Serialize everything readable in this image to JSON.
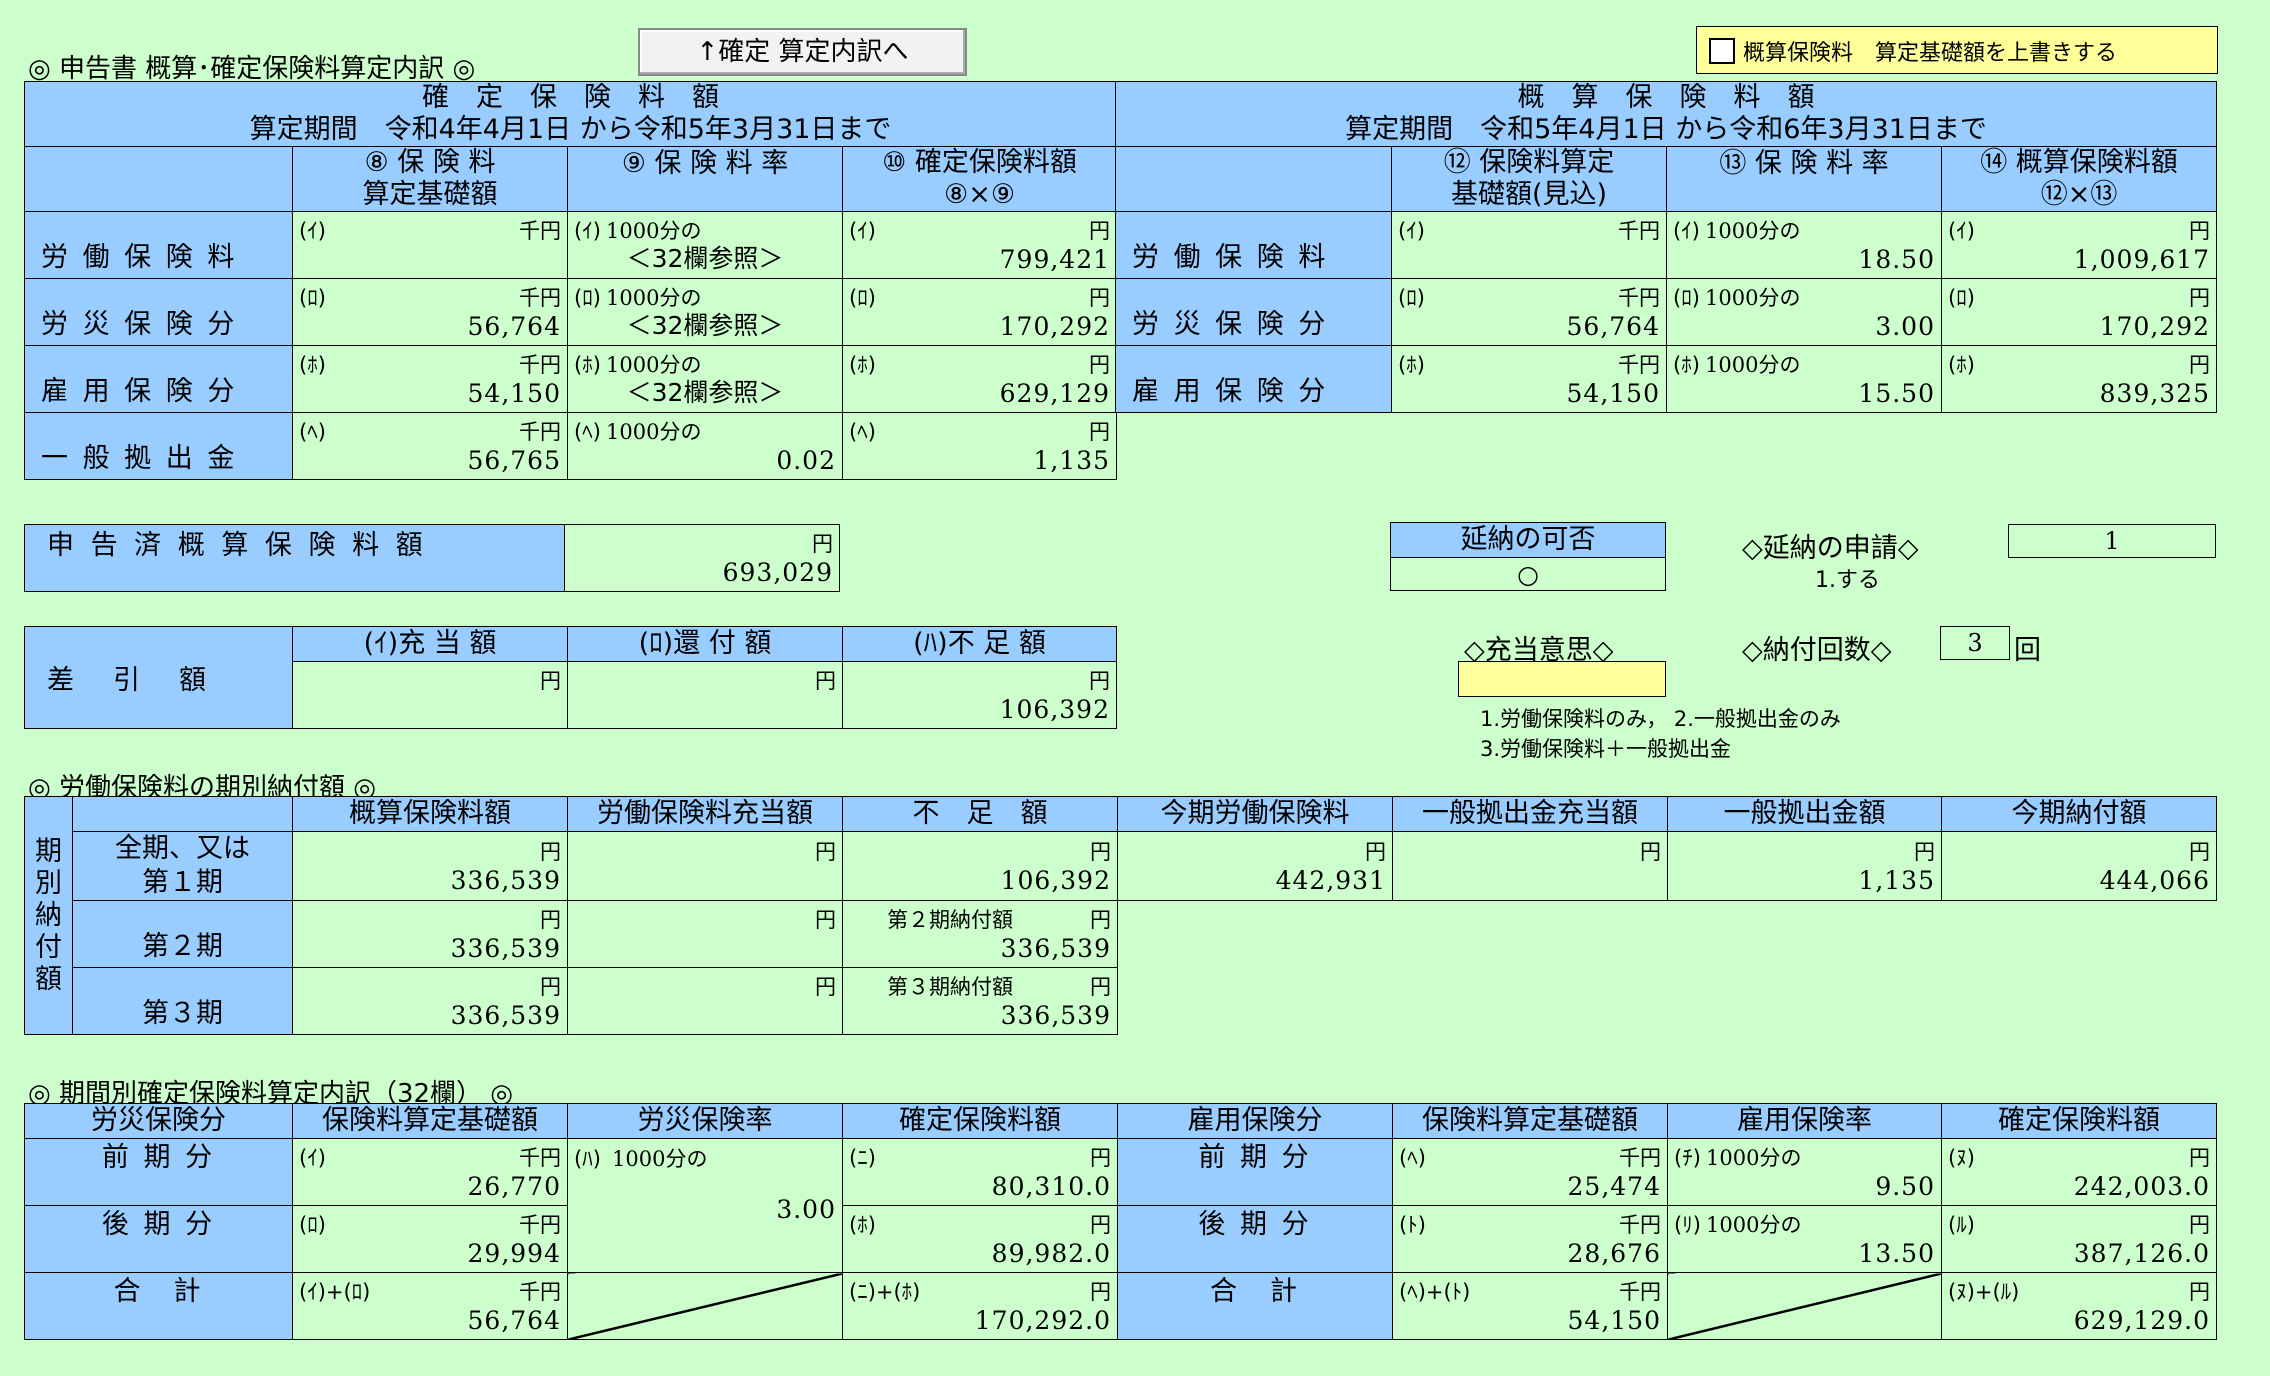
{
  "header": {
    "title": "◎ 申告書 概算･確定保険料算定内訳 ◎",
    "jump_button": "↑確定 算定内訳へ",
    "override_checkbox": "概算保険料　算定基礎額を上書きする"
  },
  "main_table": {
    "kakutei": {
      "title": "確　定　保　険　料　額",
      "period": "算定期間　令和4年4月1日 から令和5年3月31日まで",
      "col8": [
        "⑧ 保 険 料",
        "算定基礎額"
      ],
      "col9": "⑨ 保 険 料 率",
      "col10": [
        "⑩ 確定保険料額",
        "⑧×⑨"
      ],
      "rows": [
        {
          "label": "労 働 保 険 料",
          "m8": "(ｲ)",
          "u8": "千円",
          "v8": "",
          "m9": "(ｲ)",
          "r9": "1000分の",
          "v9": "＜32欄参照＞",
          "m10": "(ｲ)",
          "u10": "円",
          "v10": "799,421"
        },
        {
          "label": "労 災 保 険 分",
          "m8": "(ﾛ)",
          "u8": "千円",
          "v8": "56,764",
          "m9": "(ﾛ)",
          "r9": "1000分の",
          "v9": "＜32欄参照＞",
          "m10": "(ﾛ)",
          "u10": "円",
          "v10": "170,292"
        },
        {
          "label": "雇 用 保 険 分",
          "m8": "(ﾎ)",
          "u8": "千円",
          "v8": "54,150",
          "m9": "(ﾎ)",
          "r9": "1000分の",
          "v9": "＜32欄参照＞",
          "m10": "(ﾎ)",
          "u10": "円",
          "v10": "629,129"
        },
        {
          "label": "一 般 拠 出 金",
          "m8": "(ﾍ)",
          "u8": "千円",
          "v8": "56,765",
          "m9": "(ﾍ)",
          "r9": "1000分の",
          "v9": "0.02",
          "m10": "(ﾍ)",
          "u10": "円",
          "v10": "1,135"
        }
      ]
    },
    "gaisan": {
      "title": "概　算　保　険　料　額",
      "period": "算定期間　令和5年4月1日 から令和6年3月31日まで",
      "col12": [
        "⑫ 保険料算定",
        "基礎額(見込)"
      ],
      "col13": "⑬ 保 険 料 率",
      "col14": [
        "⑭ 概算保険料額",
        "⑫×⑬"
      ],
      "rows": [
        {
          "label": "労 働 保 険 料",
          "m12": "(ｲ)",
          "u12": "千円",
          "v12": "",
          "m13": "(ｲ)",
          "r13": "1000分の",
          "v13": "18.50",
          "m14": "(ｲ)",
          "u14": "円",
          "v14": "1,009,617"
        },
        {
          "label": "労 災 保 険 分",
          "m12": "(ﾛ)",
          "u12": "千円",
          "v12": "56,764",
          "m13": "(ﾛ)",
          "r13": "1000分の",
          "v13": "3.00",
          "m14": "(ﾛ)",
          "u14": "円",
          "v14": "170,292"
        },
        {
          "label": "雇 用 保 険 分",
          "m12": "(ﾎ)",
          "u12": "千円",
          "v12": "54,150",
          "m13": "(ﾎ)",
          "r13": "1000分の",
          "v13": "15.50",
          "m14": "(ﾎ)",
          "u14": "円",
          "v14": "839,325"
        }
      ]
    }
  },
  "shinkoku": {
    "label": "申 告 済 概 算 保 険 料 額",
    "unit": "円",
    "value": "693,029"
  },
  "ennou": {
    "kahi_label": "延納の可否",
    "kahi_value": "○",
    "shinsei_label": "◇延納の申請◇",
    "shinsei_value": "1",
    "shinsei_note": "1.する"
  },
  "sashihiki": {
    "label": "差　引　額",
    "col1": "(ｲ)充 当 額",
    "col2": "(ﾛ)還 付 額",
    "col3": "(ﾊ)不 足 額",
    "unit": "円",
    "v1": "",
    "v2": "",
    "v3": "106,392"
  },
  "juutou": {
    "label": "◇充当意思◇",
    "value": "",
    "note1": "1.労働保険料のみ，  2.一般拠出金のみ",
    "note2": "3.労働保険料＋一般拠出金",
    "kaisuu_label": "◇納付回数◇",
    "kaisuu_value": "3",
    "kaisuu_unit": "回"
  },
  "kibetsu": {
    "title": "◎ 労働保険料の期別納付額 ◎",
    "side_label": [
      "期",
      "別",
      "納",
      "付",
      "額"
    ],
    "headers": [
      "概算保険料額",
      "労働保険料充当額",
      "不　足　額",
      "今期労働保険料",
      "一般拠出金充当額",
      "一般拠出金額",
      "今期納付額"
    ],
    "unit": "円",
    "row1": {
      "label1": "全期、又は",
      "label2": "第１期",
      "values": [
        "336,539",
        "",
        "106,392",
        "442,931",
        "",
        "1,135",
        "444,066"
      ]
    },
    "row2": {
      "label": "第２期",
      "v1": "336,539",
      "v2": "",
      "note": "第２期納付額",
      "v3": "336,539"
    },
    "row3": {
      "label": "第３期",
      "v1": "336,539",
      "v2": "",
      "note": "第３期納付額",
      "v3": "336,539"
    }
  },
  "kikanbetsu": {
    "title": "◎ 期間別確定保険料算定内訳（32欄） ◎",
    "headers": [
      "労災保険分",
      "保険料算定基礎額",
      "労災保険率",
      "確定保険料額",
      "雇用保険分",
      "保険料算定基礎額",
      "雇用保険率",
      "確定保険料額"
    ],
    "rows": [
      {
        "label": "前 期 分",
        "ma": "(ｲ)",
        "ua": "千円",
        "va": "26,770",
        "mc": "(ﾆ)",
        "uc": "円",
        "vc": "80,310.0",
        "label2": "前 期 分",
        "me": "(ﾍ)",
        "ue": "千円",
        "ve": "25,474",
        "mf": "(ﾁ)",
        "rf": "1000分の",
        "vf": "9.50",
        "mg": "(ﾇ)",
        "ug": "円",
        "vg": "242,003.0"
      },
      {
        "label": "後 期 分",
        "ma": "(ﾛ)",
        "ua": "千円",
        "va": "29,994",
        "mc": "(ﾎ)",
        "uc": "円",
        "vc": "89,982.0",
        "label2": "後 期 分",
        "me": "(ﾄ)",
        "ue": "千円",
        "ve": "28,676",
        "mf": "(ﾘ)",
        "rf": "1000分の",
        "vf": "13.50",
        "mg": "(ﾙ)",
        "ug": "円",
        "vg": "387,126.0"
      },
      {
        "label": "合　計",
        "ma": "(ｲ)+(ﾛ)",
        "ua": "千円",
        "va": "56,764",
        "mc": "(ﾆ)+(ﾎ)",
        "uc": "円",
        "vc": "170,292.0",
        "label2": "合　計",
        "me": "(ﾍ)+(ﾄ)",
        "ue": "千円",
        "ve": "54,150",
        "mg": "(ﾇ)+(ﾙ)",
        "ug": "円",
        "vg": "629,129.0"
      }
    ],
    "rousai_rate_mark": "(ﾊ)",
    "rousai_rate_text": "1000分の",
    "rousai_rate": "3.00"
  }
}
